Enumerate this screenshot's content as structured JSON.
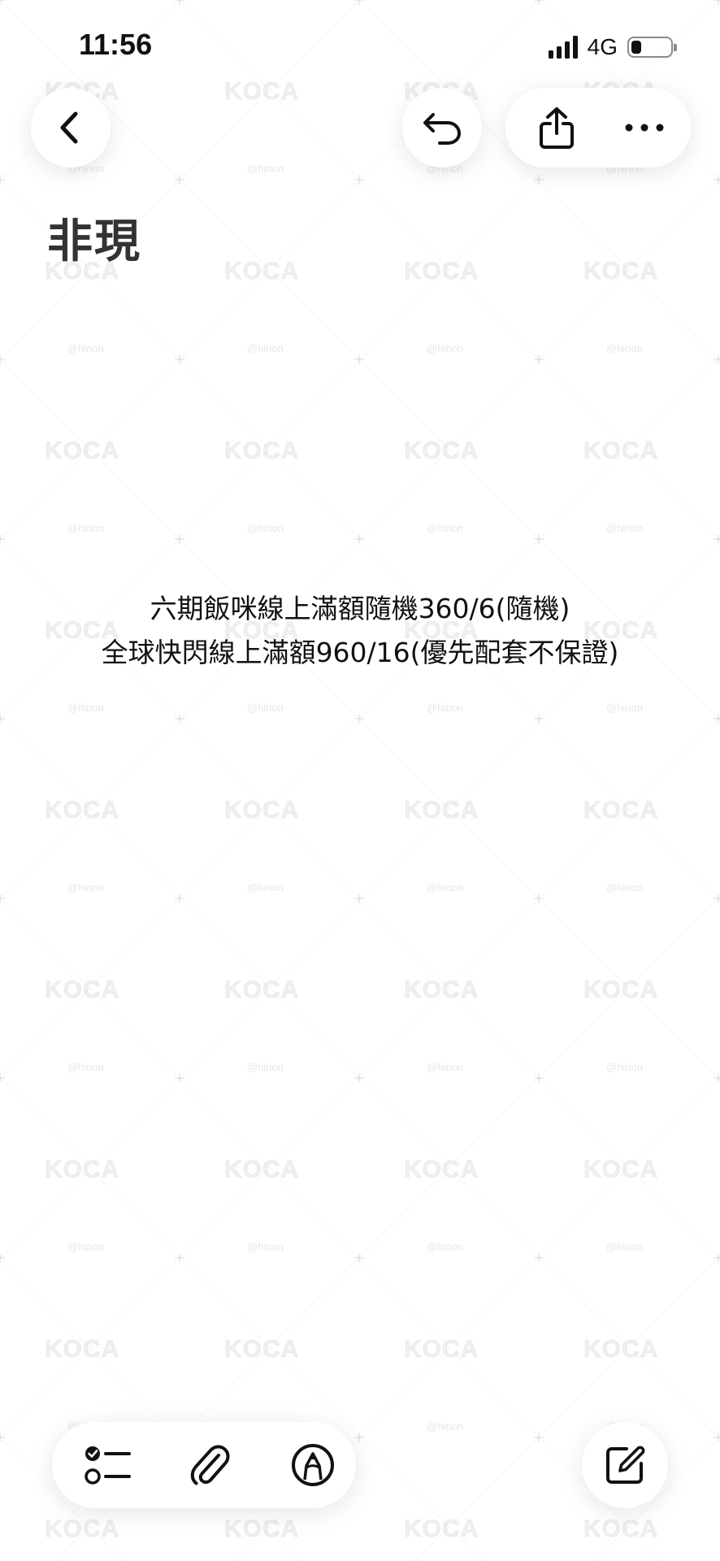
{
  "status_bar": {
    "time": "11:56",
    "network": "4G",
    "signal_bars": 4,
    "battery_level": 0.25
  },
  "nav": {
    "back_icon": "chevron-left-icon",
    "undo_icon": "undo-icon",
    "share_icon": "share-icon",
    "more_icon": "more-horizontal-icon"
  },
  "note": {
    "title": "非現",
    "lines": [
      "六期飯咪線上滿額隨機360/6(隨機)",
      "全球快閃線上滿額960/16(優先配套不保證)"
    ]
  },
  "toolbar": {
    "checklist_icon": "checklist-icon",
    "attachment_icon": "paperclip-icon",
    "markup_icon": "pen-markup-icon",
    "compose_icon": "compose-icon"
  },
  "watermark": {
    "logo_text": "KOCA",
    "handle_text": "@hinon"
  },
  "colors": {
    "text": "#111111",
    "title": "#333333",
    "background": "#ffffff"
  }
}
